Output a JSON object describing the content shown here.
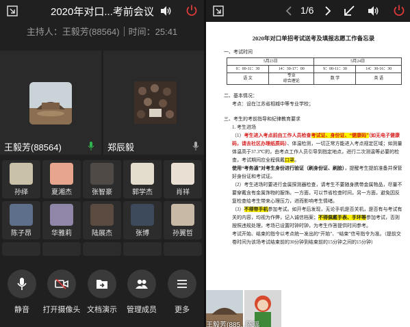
{
  "left": {
    "title": "2020年对口...考前会议",
    "host_label": "主持人：王毅芳(88564)",
    "time_label": "时间：25:41",
    "tiles": [
      {
        "name": "王毅芳(88564)"
      },
      {
        "name": "郑辰毅"
      }
    ],
    "grid": [
      {
        "name": "孙绎",
        "color": "#c9c2a8"
      },
      {
        "name": "夏湘杰",
        "color": "#e7a58d"
      },
      {
        "name": "张智豪",
        "color": "#4f4a46"
      },
      {
        "name": "郭学杰",
        "color": "#e4dccd"
      },
      {
        "name": "肖祥",
        "color": "#e9dfd3"
      },
      {
        "name": "陈子昂",
        "color": "#5d6f8a"
      },
      {
        "name": "华雅莉",
        "color": "#8f86a8"
      },
      {
        "name": "陆展杰",
        "color": "#5b4a3f"
      },
      {
        "name": "张博",
        "color": "#3d4a5c"
      },
      {
        "name": "孙翼哲",
        "color": "#c7b9a6"
      }
    ],
    "bottom": [
      {
        "label": "静音",
        "icon": "mic-icon"
      },
      {
        "label": "打开摄像头",
        "icon": "camera-off-icon"
      },
      {
        "label": "文档演示",
        "icon": "share-doc-icon"
      },
      {
        "label": "管理成员",
        "icon": "members-icon"
      },
      {
        "label": "更多",
        "icon": "menu-icon"
      }
    ]
  },
  "right": {
    "page": "1/6",
    "doc": {
      "title": "2020年对口单招考试送考及填报志愿工作备忘录",
      "s1": "一、考试时间",
      "table": {
        "date1": "5月23日",
        "date2": "5月24日",
        "t1": "9：00-11：30",
        "t2": "14：30-17：00",
        "t3": "9：00-11：30",
        "t4": "14：30-16：30",
        "sub1": "语 文",
        "sub2a": "专业",
        "sub2b": "综合理论",
        "sub3": "数 学",
        "sub4": "英 语"
      },
      "s2": "二、基本情况：",
      "s2_line": "考点：设在江苏省相城中等专业学校；",
      "s3": "三、考生的考前指导和纪律教育要求",
      "s3_1": "1. 考生进场",
      "p1_a": "（1）",
      "p1_red1": "考生进入考点前由工作人员检查",
      "p1_hl1": "考试证、身份证、“健康码”",
      "p1_red2": "（如无电子健康码，请去社区办理纸质码）",
      "p1_rest": "、体温检测，一切正常方能进入考点规定区域；如测量体温高于37.3℃的，由考点工作人员引导到指定地点，进行二次测温等必要的检查，考试期间应全程佩戴",
      "p1_hl2": "口罩",
      "p1_end": "。",
      "p1_bold": "使用“考务通”对考生身份进行验证（刷身份证、刷脸）",
      "p1_tail": "，提醒考生提前准备并保管好身份证和考试证。",
      "p2": "（2）考生进场时要进行金属探测器检查，请考生不要随身携带金属物品，尽量不要穿戴含有金属饰物的服饰。一方面，可以节省检查时间，另一方面，避免因反复检查给考生带来心理压力，进而影响考生情绪。",
      "p3_a": "（3）",
      "p3_hl": "不得带手机",
      "p3_rest": "参加考试。如开考后发现，无论手机是否关机，是否有与考试有关的内容，均视为作弊，记入诚信档案；",
      "p3_hl2": "不得佩戴手表、手环等",
      "p3_rest2": "参加考试，否则按照违规处理，考场已设置时钟时钟，为考生作答提供时间参考。",
      "p4": "考试开始、结束的指令以考点统一发出的“开始”、“结束”信号指令为准。（提前交卷时间为该场考试结束前的30分钟到结束前的15分钟之间的15分钟）"
    },
    "pip_name": "王毅芳(885...陈瑶"
  },
  "colors": {
    "accent_red": "#e03a3a",
    "mic_green": "#2fb84e",
    "highlight": "#fff200"
  }
}
